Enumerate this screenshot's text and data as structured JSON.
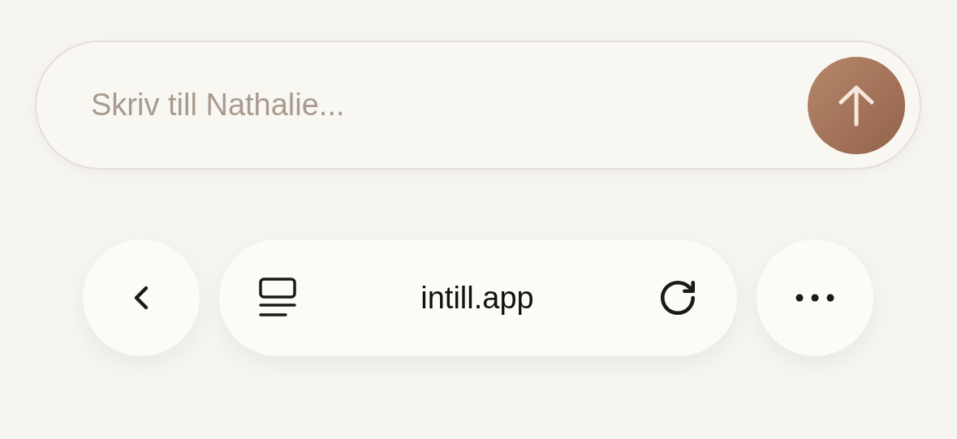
{
  "message_field": {
    "placeholder": "Skriv till Nathalie..."
  },
  "address_bar": {
    "url": "intill.app"
  }
}
